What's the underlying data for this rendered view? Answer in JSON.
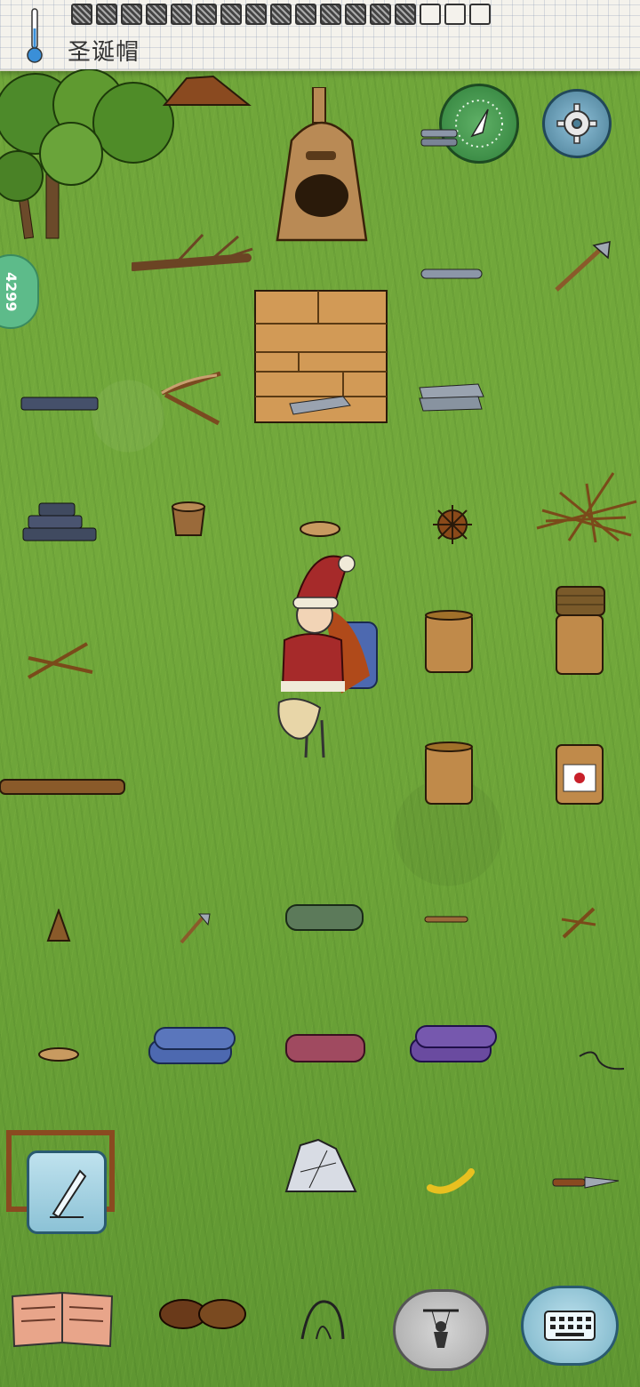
{
  "header": {
    "title": "圣诞帽",
    "stamps_filled": 14,
    "stamps_empty": 3
  },
  "side_badge": {
    "text": "4299"
  },
  "colors": {
    "grass": "#6fa53a",
    "paper": "#f4f2ec",
    "compass": "#3f8f4a",
    "gear": "#5b8fa6",
    "hat_red": "#a62a2a",
    "backpack_blue": "#4d69b0"
  }
}
